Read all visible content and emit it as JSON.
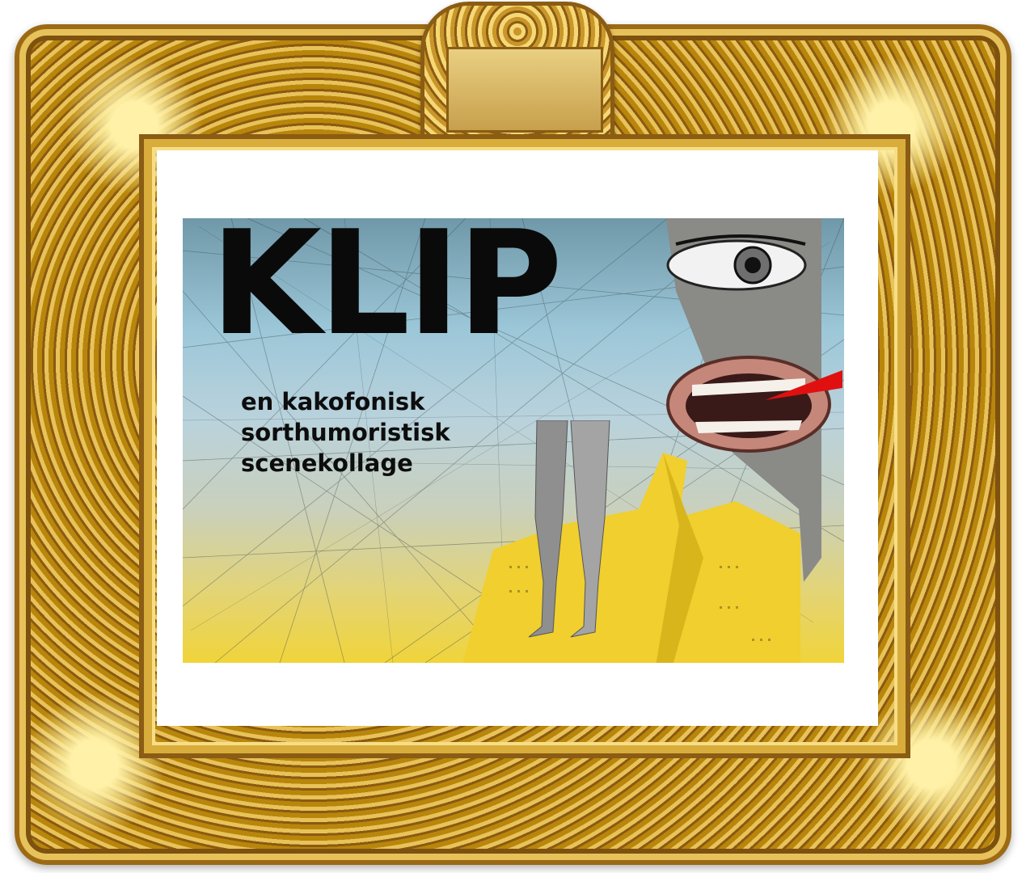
{
  "poster": {
    "title": "KLIP",
    "subtitle_lines": [
      "en kakofonisk",
      "sorthumoristisk",
      "scenekollage"
    ]
  },
  "colors": {
    "frame_gold": "#d9ad3c",
    "frame_shadow": "#8a5c14",
    "sky_blue": "#9cc7d8",
    "jacket_yellow": "#f0d43a",
    "tongue_red": "#e01010",
    "title_black": "#0a0a0a"
  },
  "icons": [
    "ornate-gilded-frame",
    "collage-face",
    "collage-legs",
    "yellow-jacket"
  ]
}
